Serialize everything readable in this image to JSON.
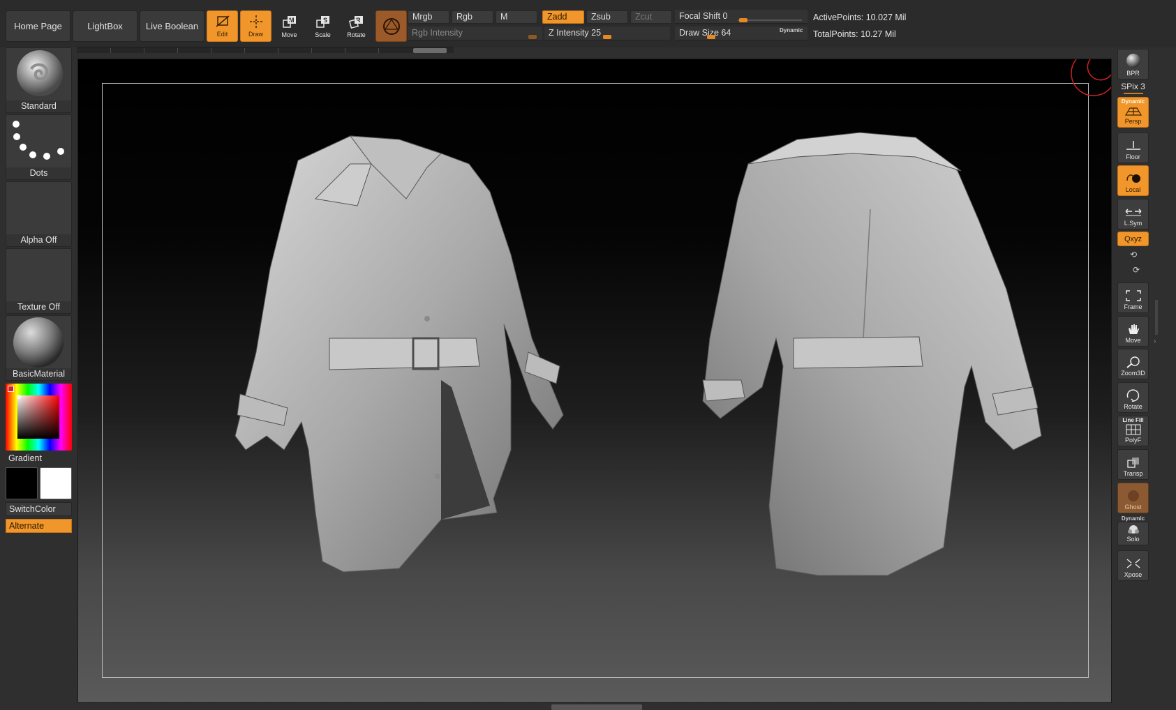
{
  "nav": {
    "home": "Home Page",
    "lightbox": "LightBox",
    "live_boolean": "Live Boolean"
  },
  "tools": {
    "edit": "Edit",
    "draw": "Draw",
    "move": "Move",
    "scale": "Scale",
    "rotate": "Rotate"
  },
  "color_modes": {
    "mrgb": "Mrgb",
    "rgb": "Rgb",
    "m": "M",
    "zadd": "Zadd",
    "zsub": "Zsub",
    "zcut": "Zcut",
    "active": "Zadd"
  },
  "sliders": {
    "rgb_intensity": "Rgb Intensity",
    "z_intensity": "Z Intensity 25",
    "focal_shift": "Focal Shift 0",
    "draw_size": "Draw Size 64",
    "dynamic_label": "Dynamic",
    "z_intensity_value": 25,
    "focal_shift_value": 0,
    "draw_size_value": 64
  },
  "stats": {
    "active_points": "ActivePoints: 10.027 Mil",
    "total_points": "TotalPoints: 10.27 Mil"
  },
  "left_shelf": {
    "brush": "Standard",
    "stroke": "Dots",
    "alpha": "Alpha Off",
    "texture": "Texture Off",
    "material": "BasicMaterial",
    "gradient": "Gradient",
    "switch_color": "SwitchColor",
    "alternate": "Alternate"
  },
  "right_shelf": {
    "bpr": "BPR",
    "spix": "SPix 3",
    "dynamic": "Dynamic",
    "persp": "Persp",
    "floor": "Floor",
    "local": "Local",
    "lsym": "L.Sym",
    "xyz": "Qxyz",
    "frame": "Frame",
    "move": "Move",
    "zoom3d": "Zoom3D",
    "rotate": "Rotate",
    "line_fill": "Line Fill",
    "polyf": "PolyF",
    "transp": "Transp",
    "ghost": "Ghost",
    "dynamic2": "Dynamic",
    "solo": "Solo",
    "xpose": "Xpose"
  },
  "colors": {
    "accent": "#f1962a",
    "primary_color": "#000000",
    "secondary_color": "#ffffff"
  }
}
